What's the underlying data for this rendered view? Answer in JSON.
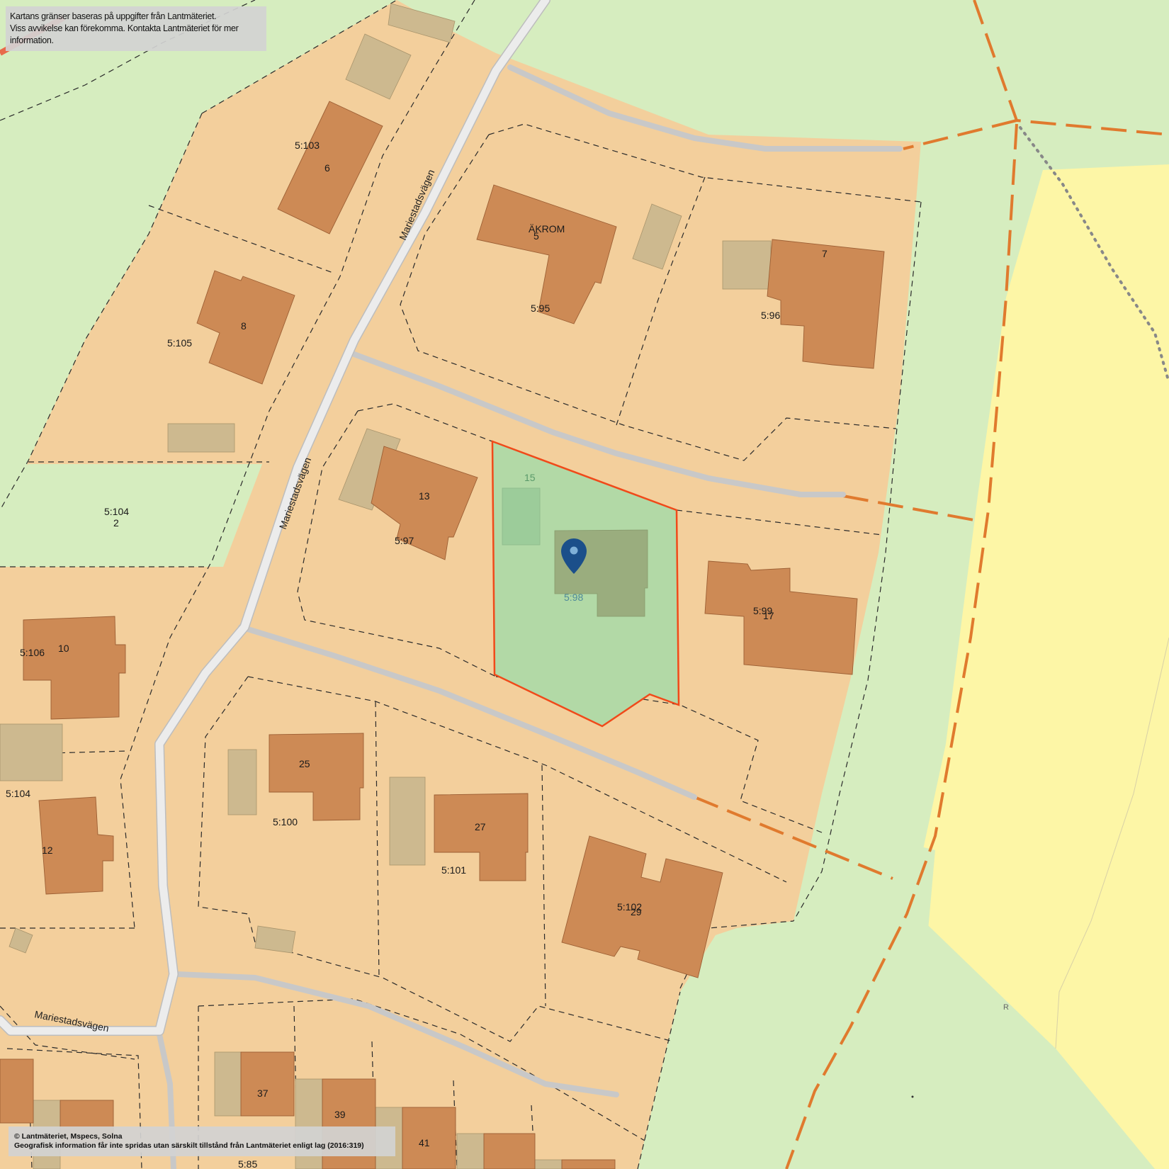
{
  "notices": {
    "top_line1": "Kartans gränser baseras på uppgifter från Lantmäteriet.",
    "top_line2": "Viss avvikelse kan förekomma. Kontakta Lantmäteriet för mer information.",
    "bottom_line1": "© Lantmäteriet, Mspecs, Solna",
    "bottom_line2": "Geografisk information får inte spridas utan särskilt tillstånd från Lantmäteriet enligt lag (2016:319)"
  },
  "roads": {
    "main_name": "Mariestadsvägen"
  },
  "selected_parcel": {
    "designation": "5:98",
    "house_number": "15"
  },
  "parcels": {
    "p5_103": "5:103",
    "p5_105": "5:105",
    "p5_104a": "5:104",
    "p5_104b": "5:104",
    "p5_106": "5:106",
    "p5_95": "5:95",
    "p5_96": "5:96",
    "p5_97": "5:97",
    "p5_99": "5:99",
    "p5_100": "5:100",
    "p5_101": "5:101",
    "p5_102": "5:102",
    "p5_85": "5:85"
  },
  "house_numbers": {
    "n6": "6",
    "n8": "8",
    "n2": "2",
    "n10": "10",
    "n12": "12",
    "n5": "5",
    "n7": "7",
    "n13": "13",
    "n17": "17",
    "n25": "25",
    "n27": "27",
    "n29": "29",
    "n37": "37",
    "n39": "39",
    "n41": "41"
  },
  "other_labels": {
    "akrom": "ÄKROM",
    "r_mark": "R"
  },
  "colors": {
    "residential": "#f3cf9c",
    "green_area": "#d6edbf",
    "field": "#fdf6a6",
    "building": "#cd8a55",
    "outbuilding": "#cdb98f",
    "road": "#ececec",
    "path": "#c8c8c8",
    "boundary_orange": "#e07a2e",
    "selected_outline": "#f04a1a",
    "selected_fill": "#b2d9a6",
    "pin": "#1b4f8a"
  },
  "icons": {
    "pin": "map-pin-icon"
  }
}
